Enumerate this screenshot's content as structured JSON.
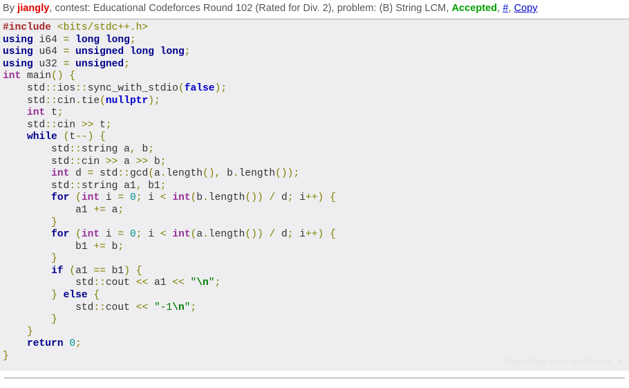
{
  "header": {
    "by_label": "By ",
    "author": "jiangly",
    "contest_label": ", contest: ",
    "contest_name": "Educational Codeforces Round 102 (Rated for Div. 2)",
    "problem_label": ", problem: ",
    "problem_name": "(B) String LCM",
    "separator": ", ",
    "verdict": "Accepted",
    "hash_link": "#",
    "copy_link": "Copy",
    "author_color": "#e00000",
    "verdict_color": "#00a000",
    "link_color": "#0000cc"
  },
  "code": {
    "language": "cpp",
    "background_color": "#eeeef0",
    "lines": [
      [
        {
          "t": "#include",
          "c": "tk-pre"
        },
        {
          "t": " ",
          "c": "tk-id"
        },
        {
          "t": "<bits/stdc++.h>",
          "c": "tk-inc"
        }
      ],
      [
        {
          "t": "using",
          "c": "tk-kw"
        },
        {
          "t": " i64 ",
          "c": "tk-id"
        },
        {
          "t": "=",
          "c": "tk-op"
        },
        {
          "t": " ",
          "c": "tk-id"
        },
        {
          "t": "long long",
          "c": "tk-kw"
        },
        {
          "t": ";",
          "c": "tk-op"
        }
      ],
      [
        {
          "t": "using",
          "c": "tk-kw"
        },
        {
          "t": " u64 ",
          "c": "tk-id"
        },
        {
          "t": "=",
          "c": "tk-op"
        },
        {
          "t": " ",
          "c": "tk-id"
        },
        {
          "t": "unsigned long long",
          "c": "tk-kw"
        },
        {
          "t": ";",
          "c": "tk-op"
        }
      ],
      [
        {
          "t": "using",
          "c": "tk-kw"
        },
        {
          "t": " u32 ",
          "c": "tk-id"
        },
        {
          "t": "=",
          "c": "tk-op"
        },
        {
          "t": " ",
          "c": "tk-id"
        },
        {
          "t": "unsigned",
          "c": "tk-kw"
        },
        {
          "t": ";",
          "c": "tk-op"
        }
      ],
      [
        {
          "t": "int",
          "c": "tk-type"
        },
        {
          "t": " main",
          "c": "tk-id"
        },
        {
          "t": "()",
          "c": "tk-op"
        },
        {
          "t": " ",
          "c": "tk-id"
        },
        {
          "t": "{",
          "c": "tk-op"
        }
      ],
      [
        {
          "t": "    std",
          "c": "tk-id"
        },
        {
          "t": "::",
          "c": "tk-op"
        },
        {
          "t": "ios",
          "c": "tk-id"
        },
        {
          "t": "::",
          "c": "tk-op"
        },
        {
          "t": "sync_with_stdio",
          "c": "tk-id"
        },
        {
          "t": "(",
          "c": "tk-op"
        },
        {
          "t": "false",
          "c": "tk-kw2"
        },
        {
          "t": ");",
          "c": "tk-op"
        }
      ],
      [
        {
          "t": "    std",
          "c": "tk-id"
        },
        {
          "t": "::",
          "c": "tk-op"
        },
        {
          "t": "cin",
          "c": "tk-id"
        },
        {
          "t": ".",
          "c": "tk-op"
        },
        {
          "t": "tie",
          "c": "tk-id"
        },
        {
          "t": "(",
          "c": "tk-op"
        },
        {
          "t": "nullptr",
          "c": "tk-kw2"
        },
        {
          "t": ");",
          "c": "tk-op"
        }
      ],
      [
        {
          "t": "    ",
          "c": "tk-id"
        },
        {
          "t": "int",
          "c": "tk-type"
        },
        {
          "t": " t",
          "c": "tk-id"
        },
        {
          "t": ";",
          "c": "tk-op"
        }
      ],
      [
        {
          "t": "    std",
          "c": "tk-id"
        },
        {
          "t": "::",
          "c": "tk-op"
        },
        {
          "t": "cin ",
          "c": "tk-id"
        },
        {
          "t": ">>",
          "c": "tk-op"
        },
        {
          "t": " t",
          "c": "tk-id"
        },
        {
          "t": ";",
          "c": "tk-op"
        }
      ],
      [
        {
          "t": "    ",
          "c": "tk-id"
        },
        {
          "t": "while",
          "c": "tk-kw"
        },
        {
          "t": " ",
          "c": "tk-id"
        },
        {
          "t": "(",
          "c": "tk-op"
        },
        {
          "t": "t",
          "c": "tk-id"
        },
        {
          "t": "--) ",
          "c": "tk-op"
        },
        {
          "t": "{",
          "c": "tk-op"
        }
      ],
      [
        {
          "t": "        std",
          "c": "tk-id"
        },
        {
          "t": "::",
          "c": "tk-op"
        },
        {
          "t": "string a",
          "c": "tk-id"
        },
        {
          "t": ",",
          "c": "tk-op"
        },
        {
          "t": " b",
          "c": "tk-id"
        },
        {
          "t": ";",
          "c": "tk-op"
        }
      ],
      [
        {
          "t": "        std",
          "c": "tk-id"
        },
        {
          "t": "::",
          "c": "tk-op"
        },
        {
          "t": "cin ",
          "c": "tk-id"
        },
        {
          "t": ">>",
          "c": "tk-op"
        },
        {
          "t": " a ",
          "c": "tk-id"
        },
        {
          "t": ">>",
          "c": "tk-op"
        },
        {
          "t": " b",
          "c": "tk-id"
        },
        {
          "t": ";",
          "c": "tk-op"
        }
      ],
      [
        {
          "t": "        ",
          "c": "tk-id"
        },
        {
          "t": "int",
          "c": "tk-type"
        },
        {
          "t": " d ",
          "c": "tk-id"
        },
        {
          "t": "=",
          "c": "tk-op"
        },
        {
          "t": " std",
          "c": "tk-id"
        },
        {
          "t": "::",
          "c": "tk-op"
        },
        {
          "t": "gcd",
          "c": "tk-id"
        },
        {
          "t": "(",
          "c": "tk-op"
        },
        {
          "t": "a",
          "c": "tk-id"
        },
        {
          "t": ".",
          "c": "tk-op"
        },
        {
          "t": "length",
          "c": "tk-id"
        },
        {
          "t": "(),",
          "c": "tk-op"
        },
        {
          "t": " b",
          "c": "tk-id"
        },
        {
          "t": ".",
          "c": "tk-op"
        },
        {
          "t": "length",
          "c": "tk-id"
        },
        {
          "t": "());",
          "c": "tk-op"
        }
      ],
      [
        {
          "t": "        std",
          "c": "tk-id"
        },
        {
          "t": "::",
          "c": "tk-op"
        },
        {
          "t": "string a1",
          "c": "tk-id"
        },
        {
          "t": ",",
          "c": "tk-op"
        },
        {
          "t": " b1",
          "c": "tk-id"
        },
        {
          "t": ";",
          "c": "tk-op"
        }
      ],
      [
        {
          "t": "        ",
          "c": "tk-id"
        },
        {
          "t": "for",
          "c": "tk-kw"
        },
        {
          "t": " ",
          "c": "tk-id"
        },
        {
          "t": "(",
          "c": "tk-op"
        },
        {
          "t": "int",
          "c": "tk-type"
        },
        {
          "t": " i ",
          "c": "tk-id"
        },
        {
          "t": "=",
          "c": "tk-op"
        },
        {
          "t": " ",
          "c": "tk-id"
        },
        {
          "t": "0",
          "c": "tk-num"
        },
        {
          "t": ";",
          "c": "tk-op"
        },
        {
          "t": " i ",
          "c": "tk-id"
        },
        {
          "t": "<",
          "c": "tk-op"
        },
        {
          "t": " ",
          "c": "tk-id"
        },
        {
          "t": "int",
          "c": "tk-type"
        },
        {
          "t": "(",
          "c": "tk-op"
        },
        {
          "t": "b",
          "c": "tk-id"
        },
        {
          "t": ".",
          "c": "tk-op"
        },
        {
          "t": "length",
          "c": "tk-id"
        },
        {
          "t": "())",
          "c": "tk-op"
        },
        {
          "t": " ",
          "c": "tk-id"
        },
        {
          "t": "/",
          "c": "tk-op"
        },
        {
          "t": " d",
          "c": "tk-id"
        },
        {
          "t": ";",
          "c": "tk-op"
        },
        {
          "t": " i",
          "c": "tk-id"
        },
        {
          "t": "++)",
          "c": "tk-op"
        },
        {
          "t": " ",
          "c": "tk-id"
        },
        {
          "t": "{",
          "c": "tk-op"
        }
      ],
      [
        {
          "t": "            a1 ",
          "c": "tk-id"
        },
        {
          "t": "+=",
          "c": "tk-op"
        },
        {
          "t": " a",
          "c": "tk-id"
        },
        {
          "t": ";",
          "c": "tk-op"
        }
      ],
      [
        {
          "t": "        ",
          "c": "tk-id"
        },
        {
          "t": "}",
          "c": "tk-op"
        }
      ],
      [
        {
          "t": "        ",
          "c": "tk-id"
        },
        {
          "t": "for",
          "c": "tk-kw"
        },
        {
          "t": " ",
          "c": "tk-id"
        },
        {
          "t": "(",
          "c": "tk-op"
        },
        {
          "t": "int",
          "c": "tk-type"
        },
        {
          "t": " i ",
          "c": "tk-id"
        },
        {
          "t": "=",
          "c": "tk-op"
        },
        {
          "t": " ",
          "c": "tk-id"
        },
        {
          "t": "0",
          "c": "tk-num"
        },
        {
          "t": ";",
          "c": "tk-op"
        },
        {
          "t": " i ",
          "c": "tk-id"
        },
        {
          "t": "<",
          "c": "tk-op"
        },
        {
          "t": " ",
          "c": "tk-id"
        },
        {
          "t": "int",
          "c": "tk-type"
        },
        {
          "t": "(",
          "c": "tk-op"
        },
        {
          "t": "a",
          "c": "tk-id"
        },
        {
          "t": ".",
          "c": "tk-op"
        },
        {
          "t": "length",
          "c": "tk-id"
        },
        {
          "t": "())",
          "c": "tk-op"
        },
        {
          "t": " ",
          "c": "tk-id"
        },
        {
          "t": "/",
          "c": "tk-op"
        },
        {
          "t": " d",
          "c": "tk-id"
        },
        {
          "t": ";",
          "c": "tk-op"
        },
        {
          "t": " i",
          "c": "tk-id"
        },
        {
          "t": "++)",
          "c": "tk-op"
        },
        {
          "t": " ",
          "c": "tk-id"
        },
        {
          "t": "{",
          "c": "tk-op"
        }
      ],
      [
        {
          "t": "            b1 ",
          "c": "tk-id"
        },
        {
          "t": "+=",
          "c": "tk-op"
        },
        {
          "t": " b",
          "c": "tk-id"
        },
        {
          "t": ";",
          "c": "tk-op"
        }
      ],
      [
        {
          "t": "        ",
          "c": "tk-id"
        },
        {
          "t": "}",
          "c": "tk-op"
        }
      ],
      [
        {
          "t": "        ",
          "c": "tk-id"
        },
        {
          "t": "if",
          "c": "tk-kw"
        },
        {
          "t": " ",
          "c": "tk-id"
        },
        {
          "t": "(",
          "c": "tk-op"
        },
        {
          "t": "a1 ",
          "c": "tk-id"
        },
        {
          "t": "==",
          "c": "tk-op"
        },
        {
          "t": " b1",
          "c": "tk-id"
        },
        {
          "t": ")",
          "c": "tk-op"
        },
        {
          "t": " ",
          "c": "tk-id"
        },
        {
          "t": "{",
          "c": "tk-op"
        }
      ],
      [
        {
          "t": "            std",
          "c": "tk-id"
        },
        {
          "t": "::",
          "c": "tk-op"
        },
        {
          "t": "cout ",
          "c": "tk-id"
        },
        {
          "t": "<<",
          "c": "tk-op"
        },
        {
          "t": " a1 ",
          "c": "tk-id"
        },
        {
          "t": "<<",
          "c": "tk-op"
        },
        {
          "t": " ",
          "c": "tk-id"
        },
        {
          "t": "\"",
          "c": "tk-str"
        },
        {
          "t": "\\n",
          "c": "tk-esc"
        },
        {
          "t": "\"",
          "c": "tk-str"
        },
        {
          "t": ";",
          "c": "tk-op"
        }
      ],
      [
        {
          "t": "        ",
          "c": "tk-id"
        },
        {
          "t": "}",
          "c": "tk-op"
        },
        {
          "t": " ",
          "c": "tk-id"
        },
        {
          "t": "else",
          "c": "tk-kw"
        },
        {
          "t": " ",
          "c": "tk-id"
        },
        {
          "t": "{",
          "c": "tk-op"
        }
      ],
      [
        {
          "t": "            std",
          "c": "tk-id"
        },
        {
          "t": "::",
          "c": "tk-op"
        },
        {
          "t": "cout ",
          "c": "tk-id"
        },
        {
          "t": "<<",
          "c": "tk-op"
        },
        {
          "t": " ",
          "c": "tk-id"
        },
        {
          "t": "\"-1",
          "c": "tk-str"
        },
        {
          "t": "\\n",
          "c": "tk-esc"
        },
        {
          "t": "\"",
          "c": "tk-str"
        },
        {
          "t": ";",
          "c": "tk-op"
        }
      ],
      [
        {
          "t": "        ",
          "c": "tk-id"
        },
        {
          "t": "}",
          "c": "tk-op"
        }
      ],
      [
        {
          "t": "    ",
          "c": "tk-id"
        },
        {
          "t": "}",
          "c": "tk-op"
        }
      ],
      [
        {
          "t": "    ",
          "c": "tk-id"
        },
        {
          "t": "return",
          "c": "tk-kw"
        },
        {
          "t": " ",
          "c": "tk-id"
        },
        {
          "t": "0",
          "c": "tk-num"
        },
        {
          "t": ";",
          "c": "tk-op"
        }
      ],
      [
        {
          "t": "}",
          "c": "tk-op"
        }
      ]
    ]
  },
  "watermark": {
    "text": "https://blog.csdn.net/diviner_s"
  }
}
